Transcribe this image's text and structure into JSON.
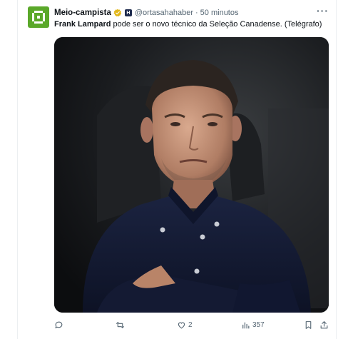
{
  "post": {
    "author_name": "Meio-campista",
    "author_handle": "@ortasahahaber",
    "separator": "·",
    "timestamp": "50 minutos",
    "affiliate_badge": "H",
    "text_bold": "Frank Lampard",
    "text_rest": " pode ser o novo técnico da Seleção Canadense. (Telégrafo)",
    "more_label": "···"
  },
  "actions": {
    "replies": "",
    "reposts": "",
    "likes": "2",
    "views": "357"
  },
  "icons": {
    "avatar": "meio-campista-logo",
    "verified": "verified-badge-gold",
    "reply": "reply-icon",
    "repost": "repost-icon",
    "like": "heart-icon",
    "views": "views-chart-icon",
    "bookmark": "bookmark-icon",
    "share": "share-icon"
  },
  "colors": {
    "avatar_bg": "#5aa82a",
    "verified": "#e2b719",
    "text_secondary": "#536471"
  }
}
